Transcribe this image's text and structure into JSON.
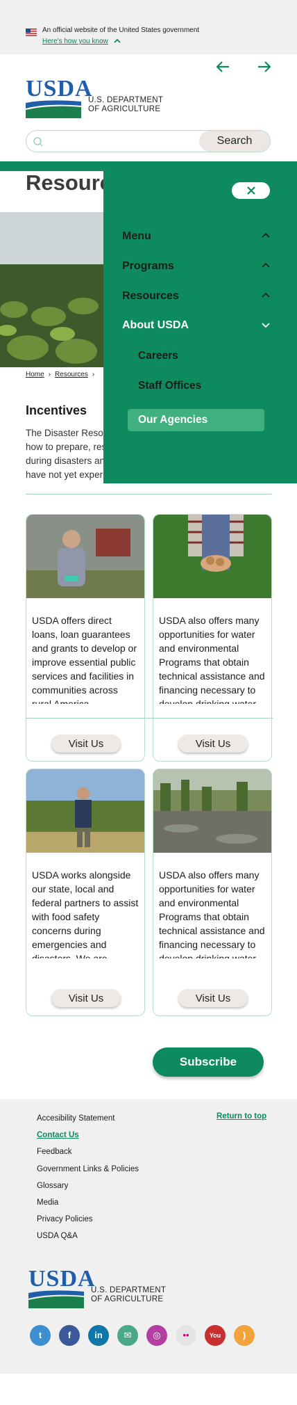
{
  "gov_banner": {
    "text": "An official website of the United States government",
    "link": "Here's how you know"
  },
  "header": {
    "logo_text": "USDA",
    "dept_line1": "U.S. DEPARTMENT",
    "dept_line2": "OF AGRICULTURE",
    "search_placeholder": "",
    "search_button": "Search"
  },
  "page": {
    "title": "Resources",
    "breadcrumb": [
      "Home",
      "Resources"
    ],
    "section_title": "Incentives",
    "intro": "The Disaster Resource Center provides information on how to prepare, respond and recover from disasters, during disasters and emergencies for communities who have not yet experienced them."
  },
  "cards": [
    {
      "text": "USDA offers direct loans, loan guarantees and grants to develop or improve essential public services and facilities in communities across rural America.",
      "button": "Visit Us"
    },
    {
      "text": "USDA also offers many opportunities for water and environmental Programs that obtain technical assistance and financing necessary to develop drinking water",
      "button": "Visit Us"
    },
    {
      "text": "USDA works alongside our state, local and federal partners to assist with food safety concerns during emergencies and disasters. We are",
      "button": "Visit Us"
    },
    {
      "text": "USDA also offers many opportunities for water and environmental Programs that obtain technical assistance and financing necessary to develop drinking water",
      "button": "Visit Us"
    }
  ],
  "subscribe_label": "Subscribe",
  "footer": {
    "links": [
      "Accesibility Statement",
      "Contact Us",
      "Feedback",
      "Government Links & Policies",
      "Glossary",
      "Media",
      "Privacy Policies",
      "USDA Q&A"
    ],
    "active_link": "Contact Us",
    "return_top": "Return to top",
    "social": [
      {
        "icon": "twitter-icon",
        "glyph": "t",
        "color": "#3d8fd0"
      },
      {
        "icon": "facebook-icon",
        "glyph": "f",
        "color": "#3b5998"
      },
      {
        "icon": "linkedin-icon",
        "glyph": "in",
        "color": "#0e76a8"
      },
      {
        "icon": "email-icon",
        "glyph": "✉",
        "color": "#4aa98a"
      },
      {
        "icon": "instagram-icon",
        "glyph": "◎",
        "color": "#b53fa1"
      },
      {
        "icon": "flickr-icon",
        "glyph": "••",
        "color": "#e4e4e4"
      },
      {
        "icon": "youtube-icon",
        "glyph": "You",
        "color": "#c8302f"
      },
      {
        "icon": "rss-icon",
        "glyph": ")",
        "color": "#f2a23a"
      }
    ]
  },
  "menu": {
    "items": [
      "Menu",
      "Programs",
      "Resources",
      "About USDA"
    ],
    "submenu": [
      "Careers",
      "Staff Offices",
      "Our Agencies"
    ],
    "active_submenu": "Our Agencies"
  },
  "colors": {
    "accent": "#0e8a5f",
    "active": "#3fb07e",
    "brand_blue": "#1f5ea8"
  }
}
